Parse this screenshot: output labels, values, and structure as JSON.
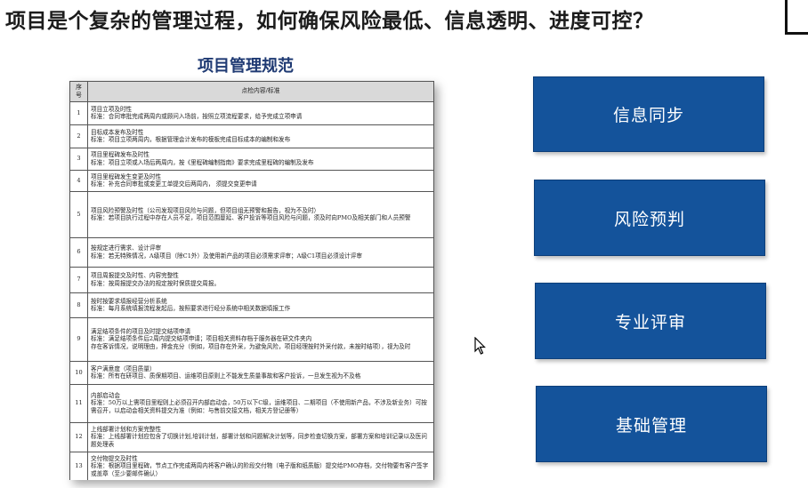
{
  "slide": {
    "title": "项目是个复杂的管理过程，如何确保风险最低、信息透明、进度可控？",
    "section_title": "项目管理规范"
  },
  "table": {
    "headers": [
      "序号",
      "点检内容/标准"
    ],
    "rows": [
      {
        "num": "1",
        "lines": [
          "项目立项及时性",
          "标准：合同审批完成两周内或顾问入场前，按照立项流程要求，给予完成立项申请"
        ]
      },
      {
        "num": "2",
        "lines": [
          "目标成本发布及时性",
          "标准：项目立项两周内，根据管理会计发布的模板完成目标成本的编制和发布"
        ]
      },
      {
        "num": "3",
        "lines": [
          "项目里程碑发布及时性",
          "标准：项目立项或入场后两周内，按《里程碑编制指南》要求完成里程碑的编制及发布"
        ]
      },
      {
        "num": "4",
        "lines": [
          "项目里程碑发生变更及时性",
          "标准：补充合同审批或变更工单提交后两周内，    须提交变更申请"
        ]
      },
      {
        "num": "5",
        "lines": [
          "项目风险预警及时性（公司发现项目风险与问题，但项目组无预警和报告，视为不及时）",
          "标准：若项目执行过程中存在人员不足，项目范围蔓延、客户投诉等项目风险与问题，须及时向PMO及相关部门和人员预警"
        ]
      },
      {
        "num": "6",
        "lines": [
          "按规定进行需求、设计评审",
          "标准：若无特殊情况，A级项目（除C1外）及使用新产品的项目必须需求评审；A级C1项目必须设计评审"
        ]
      },
      {
        "num": "7",
        "lines": [
          "项目周报提交及时性、内容完整性",
          "标准：按周报提交办法的规定按时保质提交周报。"
        ]
      },
      {
        "num": "8",
        "lines": [
          "按时按要求填报经营分析系统",
          "标准：每月系统填报流程发起后，按照要求进行经分系统中相关数据填报工作"
        ]
      },
      {
        "num": "9",
        "lines": [
          "满足结项条件的项目及时提交结项申请",
          "标准：满足结项条件后2周内提交结项申请；项目相关资料存档于服务器在研文件夹内",
          "存在客诉情况，说明理由，押金充分（例如，项目存在外采，为避免风险，项目经理按时外采付款，未按时结项），视为及时"
        ]
      },
      {
        "num": "10",
        "lines": [
          "客户满意度（项目质量）",
          "标准：所有在研项目、质保期项目、运维项目原则上不能发生质量事故和客户投诉，一旦发生视为不及格"
        ]
      },
      {
        "num": "11",
        "lines": [
          "内部启动会",
          "标准：50万以上需项目里程则上必须召开内部启动会，50万以下C级，运维项目、二期项目（不使用新产品，不涉及新业务）可按需召开，以启动会相关资料提交为准（例如：与售前交接文档，相关方登记册等）"
        ]
      },
      {
        "num": "12",
        "lines": [
          "上线部署计划和方案完整性",
          "标准：上线部署计划应包含了切换计划,培训计划，部署计划和问题解决计划等，同步检查切换方案，部署方案和培训记录以及医问题处理表"
        ]
      },
      {
        "num": "13",
        "lines": [
          "交付物提交及时性",
          "标准：根据项目里程碑，节点工作完成两周内将客户确认的阶段交付物（电子版和纸质版）提交给PMO存档，交付物要有客户签字或盖章（至少要邮件确认）"
        ]
      }
    ]
  },
  "cards": [
    "信息同步",
    "风险预判",
    "专业评审",
    "基础管理"
  ],
  "colors": {
    "card_bg": "#14539b",
    "card_text": "#ffffff",
    "section_title": "#1f3a73"
  }
}
